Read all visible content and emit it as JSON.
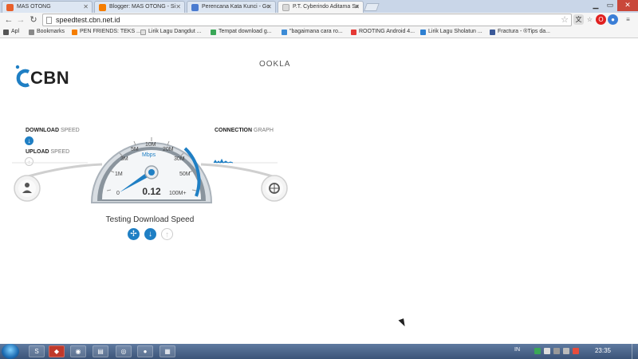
{
  "browser": {
    "tabs": [
      {
        "title": "MAS OTONG",
        "color": "#e8602c"
      },
      {
        "title": "Blogger: MAS OTONG - Si",
        "color": "#f57d00"
      },
      {
        "title": "Perencana Kata Kunci - Go",
        "color": "#4a7bd0"
      },
      {
        "title": "P.T. Cyberindo Aditama Sa",
        "color": "#d9d9d9"
      }
    ],
    "url": "speedtest.cbn.net.id",
    "bookmarks": [
      {
        "label": "Apl",
        "color": "#555"
      },
      {
        "label": "Bookmarks",
        "color": "#888"
      },
      {
        "label": "PEN FRIENDS: TEKS ...",
        "color": "#f57d00"
      },
      {
        "label": "Lirik Lagu Dangdut ...",
        "color": "#e0e0e0"
      },
      {
        "label": "Tempat download g...",
        "color": "#3aa757"
      },
      {
        "label": "\"bagaimana cara ro...",
        "color": "#3c8bd6"
      },
      {
        "label": "ROOTING Android 4...",
        "color": "#e53935"
      },
      {
        "label": "Lirik Lagu Sholatun ...",
        "color": "#2d7fd1"
      },
      {
        "label": "Fractura - ®Tips da...",
        "color": "#3b5998"
      }
    ]
  },
  "speedtest": {
    "brand": "CBN",
    "partner": "OOKLA",
    "download_label_bold": "DOWNLOAD",
    "download_label_light": " SPEED",
    "upload_label_bold": "UPLOAD",
    "upload_label_light": " SPEED",
    "connection_label_bold": "CONNECTION",
    "connection_label_light": " GRAPH",
    "unit": "Mbps",
    "reading": "0.12",
    "scale_labels": [
      "0",
      "1M",
      "3M",
      "5M",
      "10M",
      "20M",
      "30M",
      "50M",
      "100M+"
    ],
    "status": "Testing Download Speed",
    "accent": "#1f7fc4"
  },
  "taskbar": {
    "lang": "IN",
    "clock": "23:35"
  }
}
